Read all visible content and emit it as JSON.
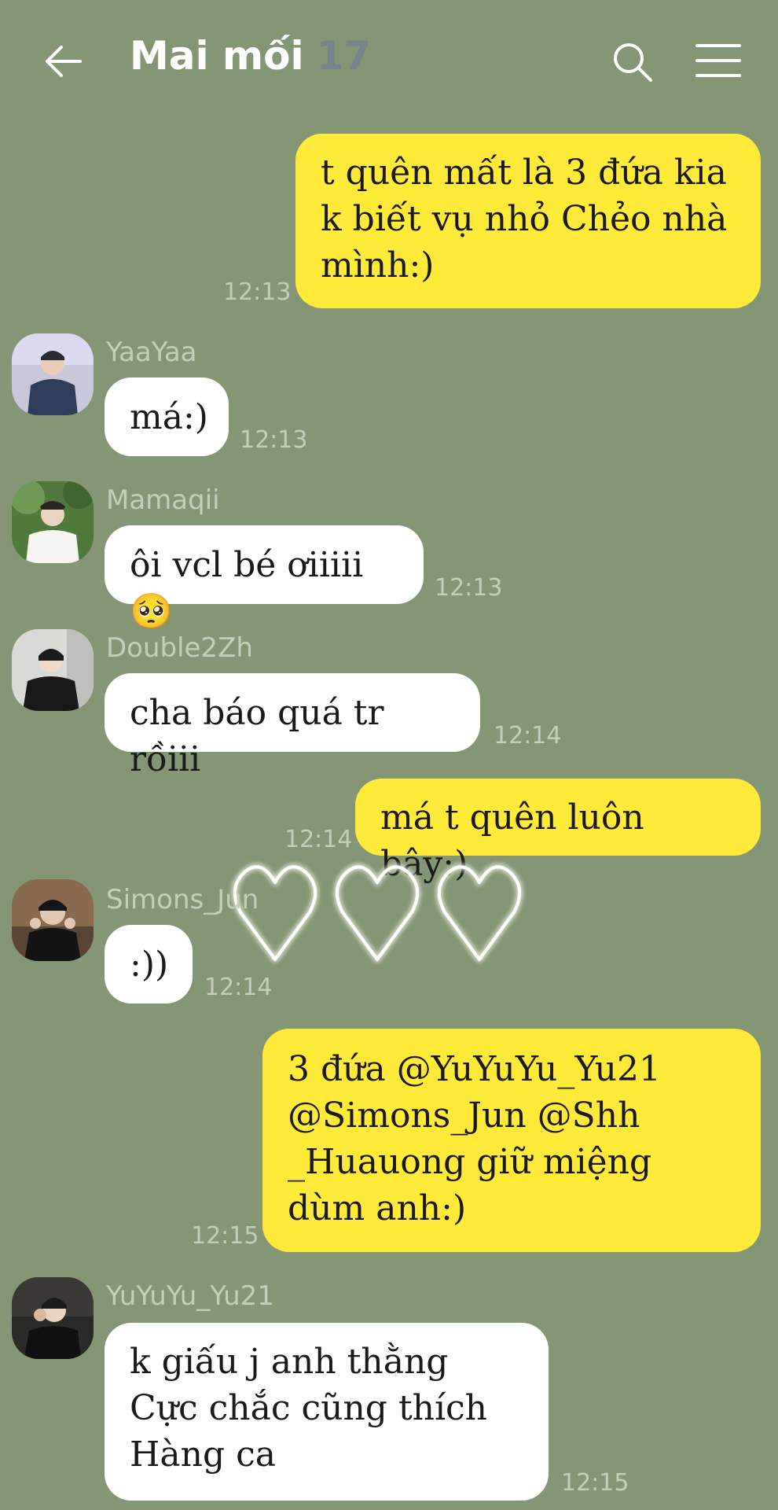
{
  "header": {
    "title": "Mai mối",
    "count": "17",
    "back_icon": "back-arrow-icon",
    "search_icon": "search-icon",
    "menu_icon": "hamburger-menu-icon"
  },
  "messages": [
    {
      "from": "me",
      "text": "t quên mất là 3 đứa kia k biết vụ nhỏ Chẻo nhà mình:)",
      "time": "12:13"
    },
    {
      "from": "YaaYaa",
      "text": "má:)",
      "time": "12:13"
    },
    {
      "from": "Mamaqii",
      "text": "ôi vcl bé ơiiiii🥺",
      "time": "12:13"
    },
    {
      "from": "Double2Zh",
      "text": "cha báo quá tr rồiii",
      "time": "12:14"
    },
    {
      "from": "me",
      "text": "má t quên luôn bây:)",
      "time": "12:14"
    },
    {
      "from": "Simons_Jun",
      "text": ":))",
      "time": "12:14"
    },
    {
      "from": "me",
      "text": "3 đứa @YuYuYu_Yu21 @Simons_Jun @Shh _Huauong giữ miệng dùm anh:)",
      "time": "12:15"
    },
    {
      "from": "YuYuYu_Yu21",
      "text": "k giấu j anh thằng Cực chắc cũng thích Hàng ca",
      "time": "12:15"
    }
  ],
  "colors": {
    "background": "#859674",
    "my_bubble": "#ffea3a",
    "other_bubble": "#ffffff",
    "meta_text": "#c4cdb8"
  }
}
